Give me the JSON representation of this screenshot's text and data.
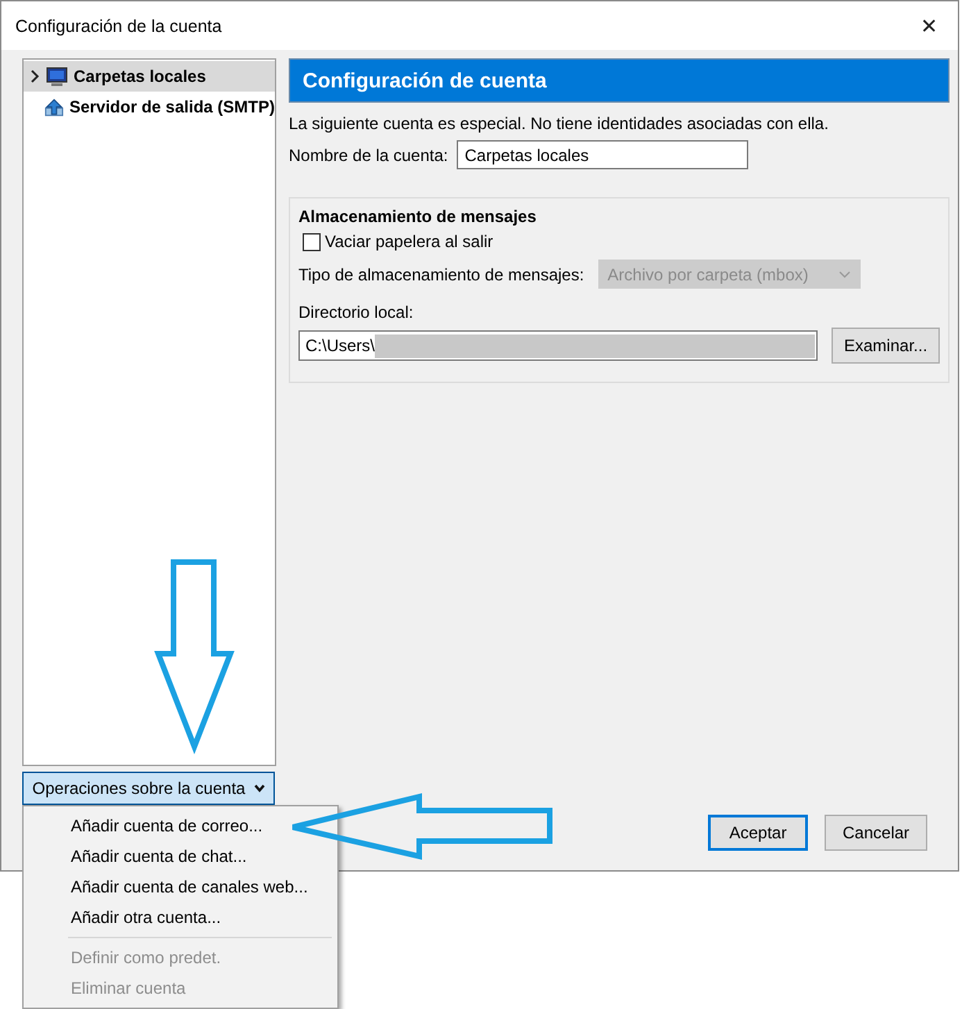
{
  "window": {
    "title": "Configuración de la cuenta",
    "close": "✕"
  },
  "tree": [
    {
      "kind": "folder",
      "label": "Carpetas locales",
      "selected": true,
      "expanded": false
    },
    {
      "kind": "server",
      "label": "Servidor de salida (SMTP)",
      "selected": false
    }
  ],
  "account_actions": {
    "label": "Operaciones sobre la cuenta",
    "open": true,
    "menu": [
      {
        "kind": "item",
        "label": "Añadir cuenta de correo...",
        "disabled": false
      },
      {
        "kind": "item",
        "label": "Añadir cuenta de chat...",
        "disabled": false
      },
      {
        "kind": "item",
        "label": "Añadir cuenta de canales web...",
        "disabled": false
      },
      {
        "kind": "item",
        "label": "Añadir otra cuenta...",
        "disabled": false
      },
      {
        "kind": "separator"
      },
      {
        "kind": "item",
        "label": "Definir como predet.",
        "disabled": true
      },
      {
        "kind": "item",
        "label": "Eliminar cuenta",
        "disabled": true
      }
    ]
  },
  "panel": {
    "title": "Configuración de cuenta",
    "note": "La siguiente cuenta es especial. No tiene identidades asociadas con ella.",
    "name_label": "Nombre de la cuenta:",
    "name_value": "Carpetas locales",
    "storage": {
      "heading": "Almacenamiento de mensajes",
      "empty_trash": {
        "label": "Vaciar papelera al salir",
        "checked": false
      },
      "type_label": "Tipo de almacenamiento de mensajes:",
      "type_value": "Archivo por carpeta (mbox)",
      "type_disabled": true,
      "dir_label": "Directorio local:",
      "dir_value": "C:\\Users\\",
      "browse": "Examinar..."
    }
  },
  "buttons": [
    {
      "label": "Aceptar",
      "default": true
    },
    {
      "label": "Cancelar",
      "default": false
    }
  ]
}
